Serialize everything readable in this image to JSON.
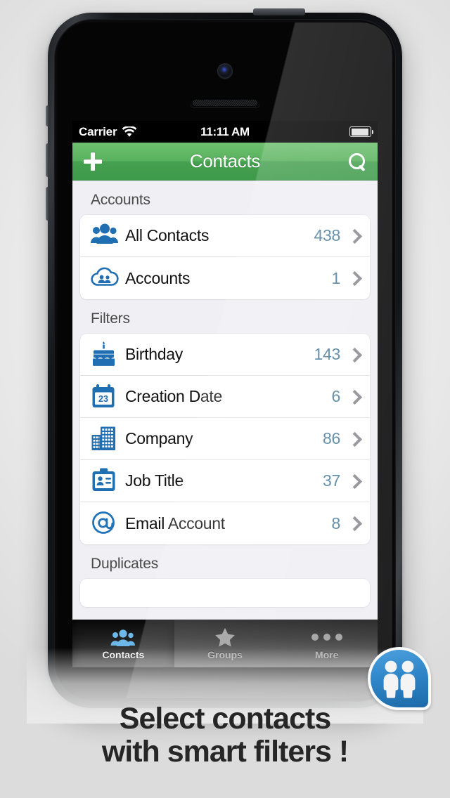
{
  "status_bar": {
    "carrier": "Carrier",
    "wifi_icon": "wifi-icon",
    "time": "11:11 AM",
    "battery_icon": "battery-icon"
  },
  "nav_bar": {
    "add_icon": "plus-icon",
    "title": "Contacts",
    "search_icon": "search-icon"
  },
  "sections": [
    {
      "header": "Accounts",
      "rows": [
        {
          "icon": "group-people-icon",
          "label": "All Contacts",
          "count": "438",
          "chevron": "chevron-right-icon"
        },
        {
          "icon": "cloud-people-icon",
          "label": "Accounts",
          "count": "1",
          "chevron": "chevron-right-icon"
        }
      ]
    },
    {
      "header": "Filters",
      "rows": [
        {
          "icon": "birthday-cake-icon",
          "label": "Birthday",
          "count": "143",
          "chevron": "chevron-right-icon"
        },
        {
          "icon": "calendar-icon",
          "label": "Creation Date",
          "count": "6",
          "chevron": "chevron-right-icon",
          "calendar_day": "23"
        },
        {
          "icon": "buildings-icon",
          "label": "Company",
          "count": "86",
          "chevron": "chevron-right-icon"
        },
        {
          "icon": "id-badge-icon",
          "label": "Job Title",
          "count": "37",
          "chevron": "chevron-right-icon"
        },
        {
          "icon": "at-sign-icon",
          "label": "Email Account",
          "count": "8",
          "chevron": "chevron-right-icon"
        }
      ]
    },
    {
      "header": "Duplicates",
      "rows": []
    }
  ],
  "tab_bar": {
    "tabs": [
      {
        "label": "Contacts",
        "icon": "people-icon",
        "active": true
      },
      {
        "label": "Groups",
        "icon": "star-icon",
        "active": false
      },
      {
        "label": "More",
        "icon": "ellipsis-icon",
        "active": false
      }
    ]
  },
  "app_badge": {
    "icon": "two-people-icon"
  },
  "caption": {
    "line1": "Select contacts",
    "line2": "with smart filters !"
  },
  "colors": {
    "nav_green_top": "#6ec070",
    "nav_green_bottom": "#3d9a4a",
    "count_blue": "#4f7f9e",
    "icon_blue": "#2273b8",
    "tab_active_blue": "#6db8e8",
    "page_background": "#eaeaea",
    "list_background": "#efeff4"
  }
}
